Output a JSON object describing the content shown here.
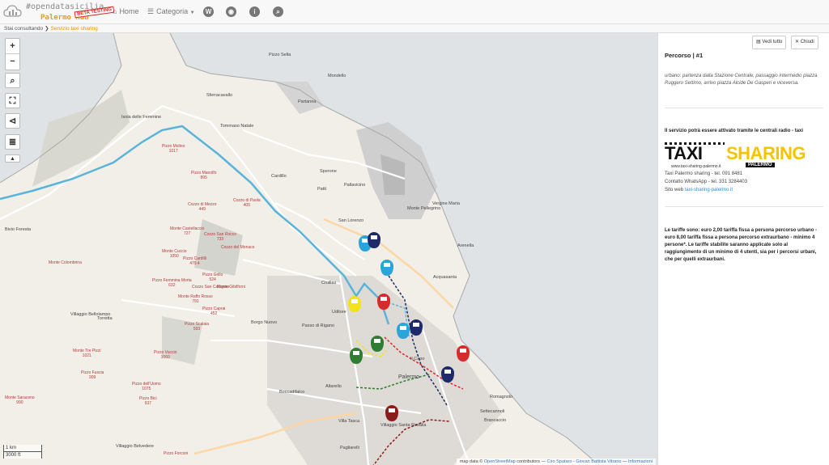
{
  "nav": {
    "brand_line1": "#opendatasicilia",
    "brand_line2": "Palermo Hub",
    "beta": "BETA TESTING",
    "home": "Home",
    "categoria": "Categoria",
    "icon_names": [
      "home-icon",
      "list-icon",
      "wikipedia-icon",
      "target-icon",
      "info-icon",
      "search-icon"
    ]
  },
  "breadcrumb": {
    "prefix": "Stai consultando",
    "current": "Servizio taxi sharing"
  },
  "map_controls": {
    "zoom_in": "+",
    "zoom_out": "−"
  },
  "map": {
    "scale_km": "1 km",
    "scale_ft": "3000 ft",
    "attribution": {
      "prefix": "map data ©",
      "osm": "OpenStreetMap",
      "contributors": "contributors —",
      "author1": "Ciro Spataro",
      "sep": "-",
      "author2": "Giovan Battista Vitrano",
      "info_sep": "—",
      "info": "Informazioni"
    },
    "places": [
      "Pizzo Sella",
      "Isola delle Femmine",
      "Sferracavallo",
      "Partanna",
      "Mondello",
      "Tommaso Natale",
      "Cardillo",
      "Patti",
      "Pallavicino",
      "Sperone",
      "San Lorenzo",
      "Monte Pellegrino",
      "Vergine Maria",
      "Arenella",
      "Acquasanta",
      "Cruillas",
      "Uditore",
      "Borgo Nuovo",
      "Passo di Rigano",
      "Boccadifalco",
      "Altarello",
      "Villaggio Belvedere",
      "Torretta",
      "Palermo",
      "Il Capo",
      "Romagnolo",
      "Brancaccio",
      "Settecannoli",
      "Villaggio Santa Rosalia",
      "Villa Tasca",
      "Pagliarelli",
      "Bivio Foresta",
      "Villaggio Bellolampo"
    ],
    "peaks": [
      "Pizzo Molino",
      "Pizzo Manolfo",
      "Cozzo di Paola",
      "Cozzo di Mezzo",
      "Monte Castellaccio",
      "Cozzo San Rocco",
      "Monte Cuccio",
      "Pizzo Cardilli",
      "Monte Colombrina",
      "Pizzo Grillo",
      "Pizzo Femmina Morta",
      "Monte Raffo Rosso",
      "Pizzo Caprai",
      "Pizzo Scalaia",
      "Monte Tre Pizzi",
      "Pizzo Vuccio",
      "Pizzo dell'Uomo",
      "Pizzo Bici",
      "Pizzo Fuscia",
      "Monte Saraceno",
      "Pizzo Forconi",
      "Cozzo del Monaco",
      "Cozzo San Calogero",
      "Monte Gibilforni"
    ],
    "peak_heights": [
      "1017",
      "895",
      "405",
      "449",
      "727",
      "733",
      "1050",
      "479.4",
      "624",
      "524",
      "632",
      "791",
      "452",
      "593",
      "1021",
      "1060",
      "1075",
      "937",
      "909",
      "990"
    ]
  },
  "panel": {
    "btn_all": "Vedi tutto",
    "btn_close": "Chiudi",
    "title": "Percorso | #1",
    "description": "urbano: partenza dalla Stazione Centrale, passaggio intermedio piazza Ruggero Settimo, arrivo piazza Alcide De Gasperi e viceversa.",
    "activation": "Il servizio potrà essere attivato tramite le centrali radio - taxi",
    "logo_taxi": "TAXI",
    "logo_sharing": "SHARING",
    "logo_palermo": "PALERMO",
    "logo_url": "www.taxi-sharing-palermo.it",
    "phone": "Taxi Palermo sharing - tel. 091 8481",
    "whatsapp": "Contatto WhatsApp - tel. 331 3284403",
    "site_label": "Sito web",
    "site_link": "taxi-sharing-palermo.it",
    "tariffs": "Le tariffe sono: euro 2,00 tariffa fissa a persona percorso urbano - euro 8,00 tariffa fissa a persona percorso extraurbano - minimo 4 persone*. Le tariffe stabilite saranno applicate solo al raggiungimento di un minimo di 4 utenti, sia per i percorsi urbani, che per quelli extraurbani."
  },
  "colors": {
    "accent_orange": "#f08c00",
    "route_lightblue": "#5ab4d9",
    "marker_navy": "#1f2a6b",
    "marker_red": "#d62b2b",
    "marker_yellow": "#f2e21a",
    "marker_green": "#2f7d32",
    "marker_darkred": "#8b1c1c",
    "sea": "#aad3df"
  }
}
